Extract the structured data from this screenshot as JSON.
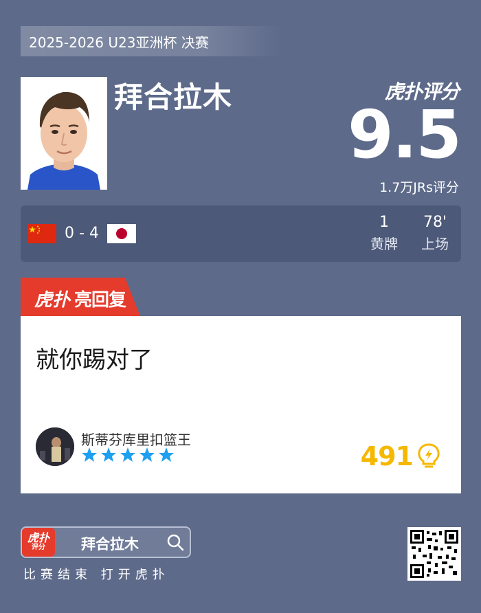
{
  "event": {
    "title": "2025-2026 U23亚洲杯 决赛"
  },
  "player": {
    "name": "拜合拉木"
  },
  "brand": {
    "logo_text": "虎扑评分"
  },
  "rating": {
    "score": "9.5",
    "count_label": "1.7万JRs评分"
  },
  "match": {
    "home_flag": "china-flag-icon",
    "away_flag": "japan-flag-icon",
    "score": "0 - 4",
    "stats": [
      {
        "value": "1",
        "label": "黄牌"
      },
      {
        "value": "78'",
        "label": "上场"
      }
    ]
  },
  "reply": {
    "tab_label": "亮回复",
    "tab_logo": "虎扑",
    "text": "就你踢对了",
    "username": "斯蒂芬库里扣篮王",
    "stars": 5,
    "likes": "491"
  },
  "footer": {
    "app_icon_top": "虎扑",
    "app_icon_bottom": "评分",
    "search_term": "拜合拉木",
    "cta": "比赛结束 打开虎扑"
  },
  "colors": {
    "background": "#5d6a8a",
    "strip": "#4d5978",
    "accent_red": "#e53b2c",
    "star_blue": "#1ea0f0",
    "likes_yellow": "#f5b800"
  }
}
